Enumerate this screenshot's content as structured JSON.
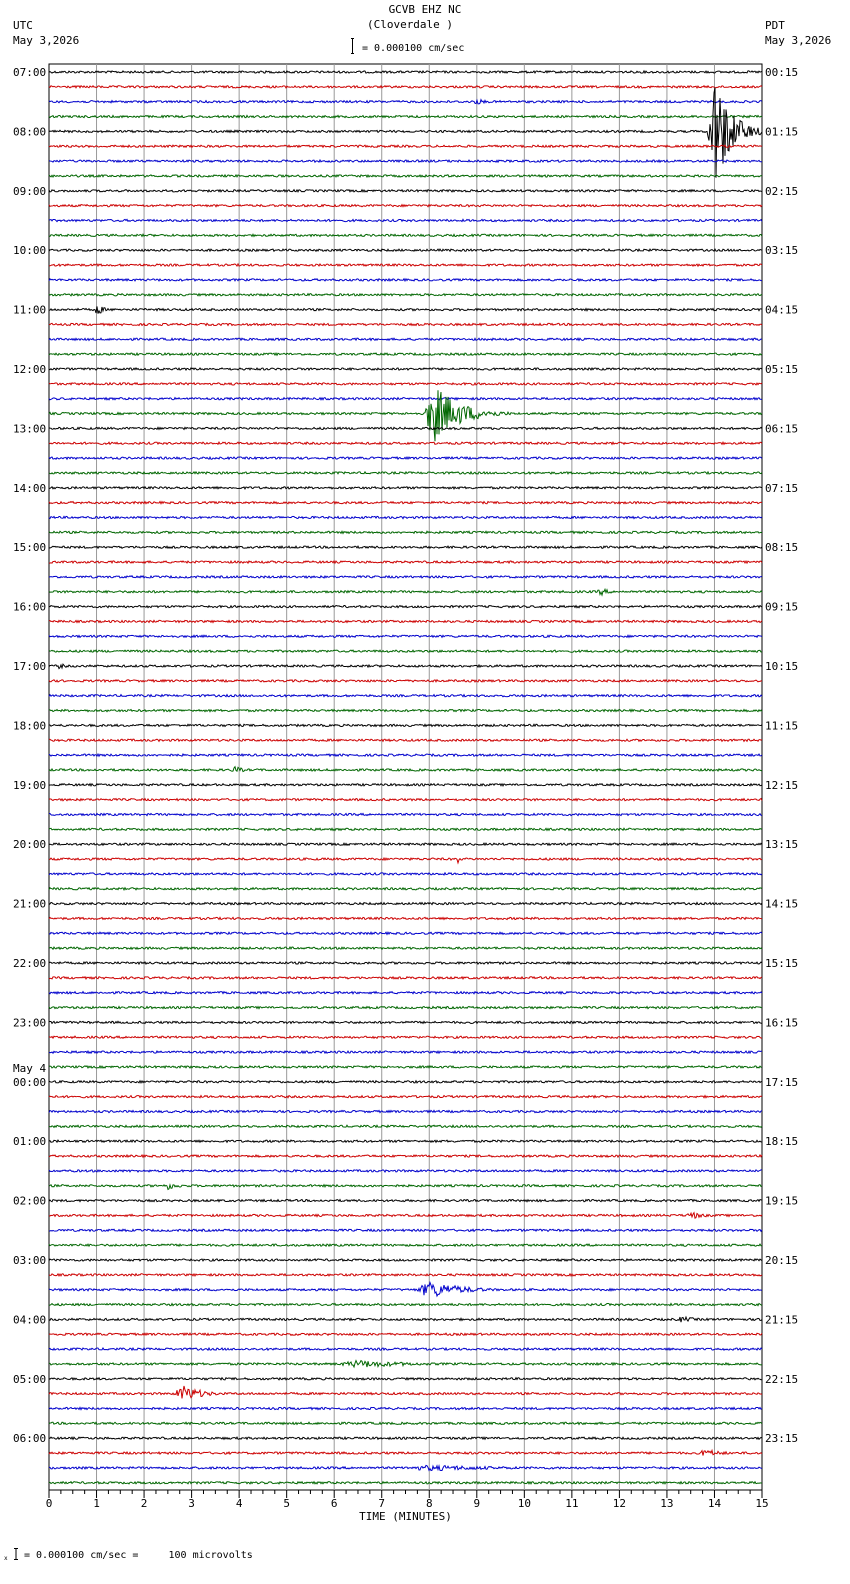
{
  "header": {
    "station_line": "GCVB EHZ NC",
    "location_line": "(Cloverdale )",
    "scale_text": "= 0.000100 cm/sec",
    "left_tz": "UTC",
    "left_date": "May 3,2026",
    "right_tz": "PDT",
    "right_date": "May 3,2026"
  },
  "footer": {
    "scale_text": "= 0.000100 cm/sec =     100 microvolts"
  },
  "chart_data": {
    "type": "seismogram",
    "title": "GCVB EHZ NC (Cloverdale )",
    "xlabel": "TIME (MINUTES)",
    "x_ticks": [
      "0",
      "1",
      "2",
      "3",
      "4",
      "5",
      "6",
      "7",
      "8",
      "9",
      "10",
      "11",
      "12",
      "13",
      "14",
      "15"
    ],
    "xlim": [
      0,
      15
    ],
    "trace_colors": [
      "#000000",
      "#cc0000",
      "#0000cc",
      "#006600"
    ],
    "traces_per_hour": 4,
    "trace_count": 96,
    "date_change": {
      "label": "May 4",
      "before_hour_index": 17
    },
    "left_hour_labels": [
      "07:00",
      "08:00",
      "09:00",
      "10:00",
      "11:00",
      "12:00",
      "13:00",
      "14:00",
      "15:00",
      "16:00",
      "17:00",
      "18:00",
      "19:00",
      "20:00",
      "21:00",
      "22:00",
      "23:00",
      "00:00",
      "01:00",
      "02:00",
      "03:00",
      "04:00",
      "05:00",
      "06:00"
    ],
    "right_hour_labels": [
      "00:15",
      "01:15",
      "02:15",
      "03:15",
      "04:15",
      "05:15",
      "06:15",
      "07:15",
      "08:15",
      "09:15",
      "10:15",
      "11:15",
      "12:15",
      "13:15",
      "14:15",
      "15:15",
      "16:15",
      "17:15",
      "18:15",
      "19:15",
      "20:15",
      "21:15",
      "22:15",
      "23:15"
    ],
    "events": [
      {
        "trace": 4,
        "minute": 14.0,
        "duration": 1.0,
        "amplitude": 60
      },
      {
        "trace": 2,
        "minute": 9.0,
        "duration": 0.8,
        "amplitude": 3
      },
      {
        "trace": 16,
        "minute": 1.0,
        "duration": 0.4,
        "amplitude": 7
      },
      {
        "trace": 23,
        "minute": 8.1,
        "duration": 1.6,
        "amplitude": 30
      },
      {
        "trace": 35,
        "minute": 11.6,
        "duration": 0.6,
        "amplitude": 4
      },
      {
        "trace": 40,
        "minute": 0.2,
        "duration": 0.6,
        "amplitude": 3
      },
      {
        "trace": 47,
        "minute": 3.9,
        "duration": 0.6,
        "amplitude": 4
      },
      {
        "trace": 53,
        "minute": 8.6,
        "duration": 0.1,
        "amplitude": 6
      },
      {
        "trace": 75,
        "minute": 2.5,
        "duration": 0.8,
        "amplitude": 4
      },
      {
        "trace": 77,
        "minute": 13.5,
        "duration": 0.9,
        "amplitude": 4
      },
      {
        "trace": 82,
        "minute": 8.0,
        "duration": 2.0,
        "amplitude": 9
      },
      {
        "trace": 84,
        "minute": 13.3,
        "duration": 1.2,
        "amplitude": 3
      },
      {
        "trace": 87,
        "minute": 6.5,
        "duration": 3.5,
        "amplitude": 4
      },
      {
        "trace": 89,
        "minute": 2.8,
        "duration": 1.2,
        "amplitude": 9
      },
      {
        "trace": 93,
        "minute": 13.8,
        "duration": 1.2,
        "amplitude": 4
      },
      {
        "trace": 94,
        "minute": 8.0,
        "duration": 5.5,
        "amplitude": 3
      }
    ]
  }
}
